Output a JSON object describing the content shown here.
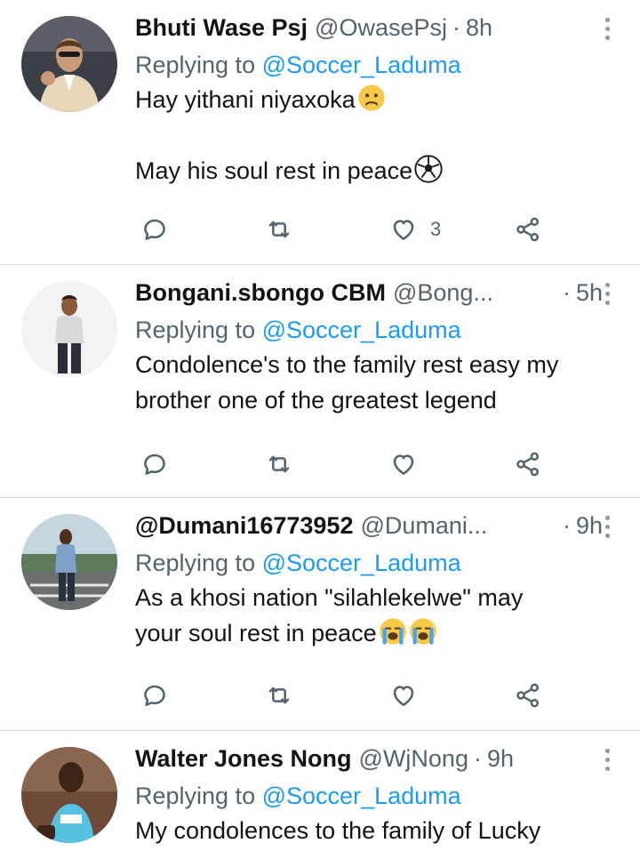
{
  "reply_prefix": "Replying to",
  "tweets": [
    {
      "name": "Bhuti Wase Psj",
      "handle": "@OwasePsj",
      "dot": "·",
      "time": "8h",
      "replying_to": "@Soccer_Laduma",
      "lines": [
        "Hay yithani niyaxoka",
        "May his soul rest in peace"
      ],
      "likes": "3",
      "emojis": [
        "frowning-face-emoji",
        "soccer-ball-emoji"
      ]
    },
    {
      "name": "Bongani.sbongo CBM",
      "handle": "@Bong...",
      "dot": "·",
      "time": "5h",
      "replying_to": "@Soccer_Laduma",
      "lines": [
        "Condolence's to the family rest easy my",
        "brother one of the greatest legend"
      ],
      "likes": ""
    },
    {
      "name": "@Dumani16773952",
      "handle": "@Dumani...",
      "dot": "·",
      "time": "9h",
      "replying_to": "@Soccer_Laduma",
      "lines": [
        "As a khosi nation \"silahlekelwe\" may",
        "your soul rest in peace"
      ],
      "likes": "",
      "emojis": [
        "loudly-crying-face-emoji",
        "loudly-crying-face-emoji"
      ]
    },
    {
      "name": "Walter Jones Nong",
      "handle": "@WjNong",
      "dot": "·",
      "time": "9h",
      "replying_to": "@Soccer_Laduma",
      "lines": [
        "My condolences to the family of Lucky"
      ],
      "likes": ""
    }
  ],
  "colors": {
    "text": "#0f1419",
    "secondary": "#536471",
    "link": "#1d9bf0",
    "divider": "#cfd9de"
  }
}
